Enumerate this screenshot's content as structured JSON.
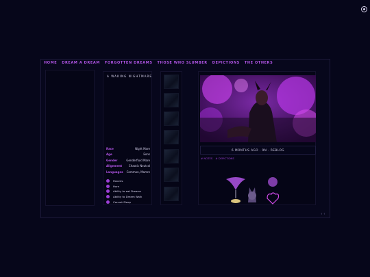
{
  "nav": {
    "items": [
      "HOME",
      "DREAM A DREAM",
      "FORGOTTEN DREAMS",
      "THOSE WHO SLUMBER",
      "DEPICTIONS",
      "THE OTHERS"
    ]
  },
  "profile": {
    "title": "A WAKING NIGHTMARE",
    "stats": [
      {
        "label": "Race",
        "value": "Night Mare"
      },
      {
        "label": "Age",
        "value": "Eons"
      },
      {
        "label": "Gender",
        "value": "Genderfluid Mare"
      },
      {
        "label": "Alignment",
        "value": "Chaotic Neutral"
      },
      {
        "label": "Languages",
        "value": "Common, Mamre"
      }
    ],
    "abilities": [
      "Hooves",
      "Horn",
      "Ability to eat Dreams",
      "Ability to Dream Walk",
      "Cannot Sleep"
    ]
  },
  "post": {
    "meta": "6 MONTHS AGO  ·  9N  ·  REBLOG",
    "tags": [
      "# NOTES",
      "# DEPICTIONS"
    ]
  },
  "footer": {
    "right": "↑ ↑"
  },
  "colors": {
    "accent": "#b255e6",
    "background": "#06061a",
    "text": "#d8d3ee"
  }
}
